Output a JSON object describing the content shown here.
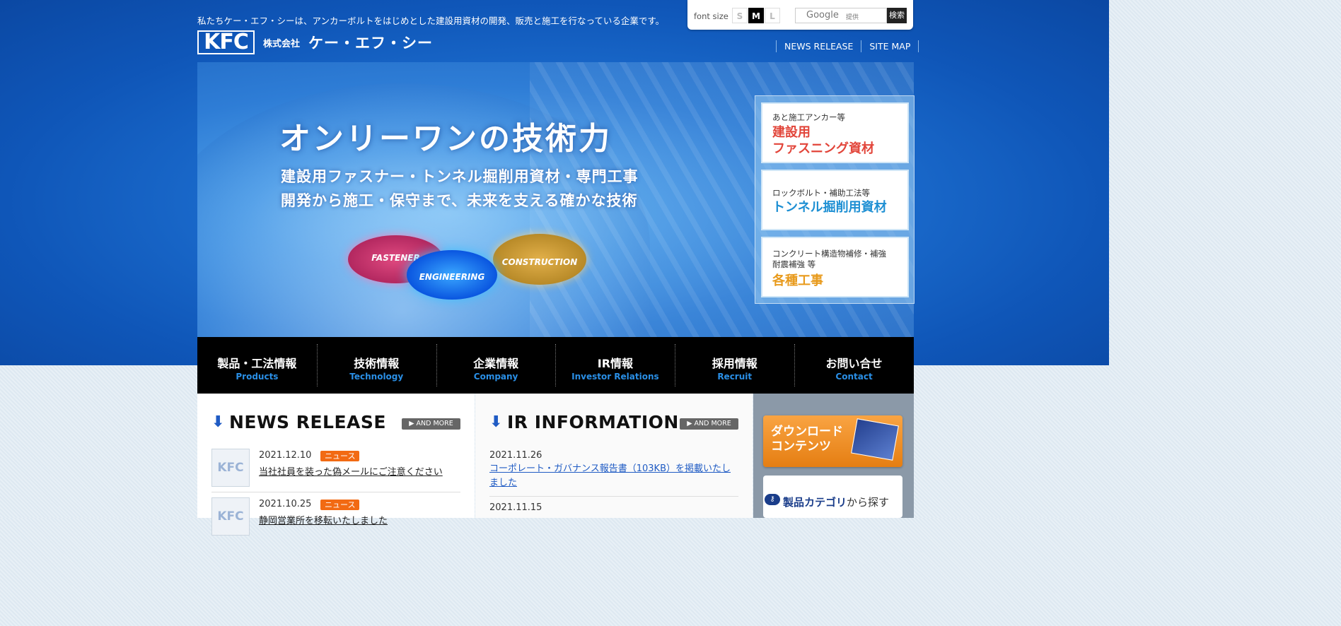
{
  "header": {
    "tagline": "私たちケー・エフ・シーは、アンカーボルトをはじめとした建設用資材の開発、販売と施工を行なっている企業です。",
    "logo_mark": "KFC",
    "logo_company_type": "株式会社",
    "logo_name": "ケー・エフ・シー"
  },
  "utility": {
    "font_size_label": "font size",
    "font_sizes": [
      "S",
      "M",
      "L"
    ],
    "selected_font_size": "M",
    "search_brand": "Google",
    "search_provided": "提供",
    "search_button": "検索"
  },
  "top_links": [
    "NEWS RELEASE",
    "SITE MAP"
  ],
  "hero": {
    "title": "オンリーワンの技術力",
    "sub1": "建設用ファスナー・トンネル掘削用資材・専門工事",
    "sub2": "開発から施工・保守まで、未来を支える確かな技術",
    "ellipses": [
      "FASTENER",
      "ENGINEERING",
      "CONSTRUCTION"
    ]
  },
  "categories": [
    {
      "small": "あと施工アンカー等",
      "big1": "建設用",
      "big2": "ファスニング資材",
      "color": "#e2453a"
    },
    {
      "small": "ロックボルト・補助工法等",
      "big1": "トンネル掘削用資材",
      "big2": "",
      "color": "#1d8fd3"
    },
    {
      "small": "コンクリート構造物補修・補強",
      "small2": "耐震補強 等",
      "big1": "各種工事",
      "big2": "",
      "color": "#e89a1c"
    }
  ],
  "nav": [
    {
      "ja": "製品・工法情報",
      "en": "Products"
    },
    {
      "ja": "技術情報",
      "en": "Technology"
    },
    {
      "ja": "企業情報",
      "en": "Company"
    },
    {
      "ja": "IR情報",
      "en": "Investor Relations"
    },
    {
      "ja": "採用情報",
      "en": "Recruit"
    },
    {
      "ja": "お問い合せ",
      "en": "Contact"
    }
  ],
  "news": {
    "title": "NEWS RELEASE",
    "more": "▶ AND MORE",
    "items": [
      {
        "date": "2021.12.10",
        "badge": "ニュース",
        "text": "当社社員を装った偽メールにご注意ください",
        "thumb": "KFC"
      },
      {
        "date": "2021.10.25",
        "badge": "ニュース",
        "text": "静岡営業所を移転いたしました",
        "thumb": "KFC"
      }
    ]
  },
  "ir": {
    "title": "IR INFORMATION",
    "more": "▶ AND MORE",
    "items": [
      {
        "date": "2021.11.26",
        "text": "コーポレート・ガバナンス報告書（103KB）を掲載いたしました"
      },
      {
        "date": "2021.11.15",
        "text": ""
      }
    ]
  },
  "side": {
    "download_line1": "ダウンロード",
    "download_line2": "コンテンツ",
    "category_search_strong": "製品カテゴリ",
    "category_search_rest": "から探す"
  }
}
